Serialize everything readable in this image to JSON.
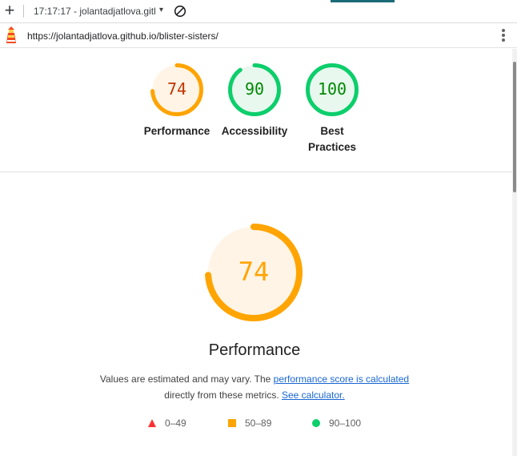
{
  "browser": {
    "new_tab_symbol": "+",
    "tab_title": "17:17:17 - jolantadjatlova.gitl",
    "dropdown_symbol": "▾",
    "url": "https://jolantadjatlova.github.io/blister-sisters/"
  },
  "summary": {
    "performance": {
      "score": "74",
      "value": 74,
      "label": "Performance",
      "color": "#ffa400",
      "text_color": "#c33300",
      "fill": "#fff4e6"
    },
    "accessibility": {
      "score": "90",
      "value": 90,
      "label": "Accessibility",
      "color": "#0cce6b",
      "text_color": "#008800",
      "fill": "#e8f8ef"
    },
    "best_practices": {
      "score": "100",
      "value": 100,
      "label_line1": "Best",
      "label_line2": "Practices",
      "color": "#0cce6b",
      "text_color": "#008800",
      "fill": "#e8f8ef"
    }
  },
  "detail": {
    "score": "74",
    "value": 74,
    "title": "Performance",
    "desc_prefix": "Values are estimated and may vary. The ",
    "desc_link1": "performance score is calculated",
    "desc_middle": "directly from these metrics. ",
    "desc_link2": "See calculator.",
    "color": "#ffa400",
    "text_color": "#ffa400",
    "fill": "#fff4e6"
  },
  "legend": [
    {
      "range": "0–49",
      "shape": "triangle",
      "color": "#ff3333"
    },
    {
      "range": "50–89",
      "shape": "square",
      "color": "#ffa400"
    },
    {
      "range": "90–100",
      "shape": "circle",
      "color": "#0cce6b"
    }
  ]
}
